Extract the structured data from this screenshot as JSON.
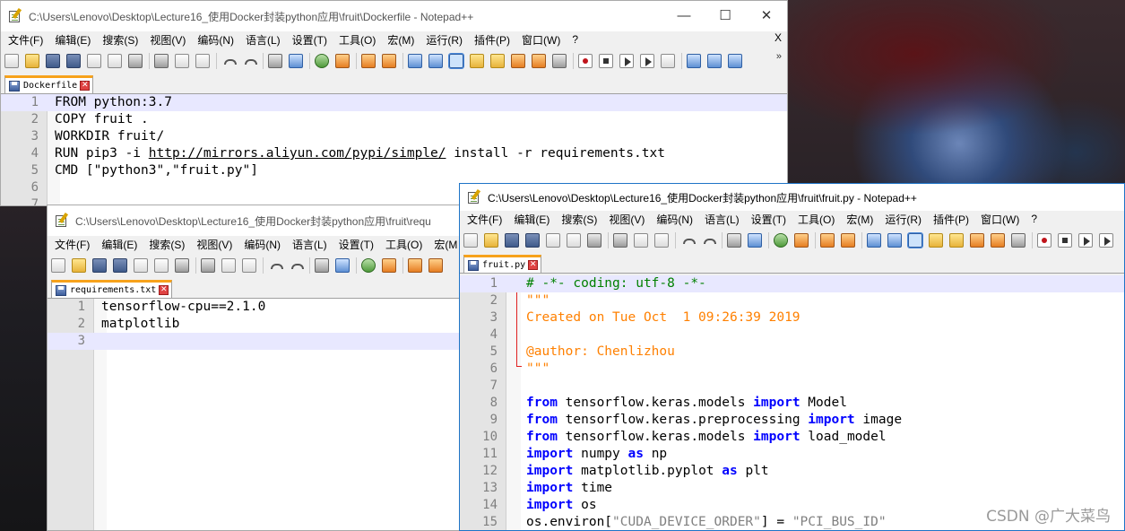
{
  "win1": {
    "title": "C:\\Users\\Lenovo\\Desktop\\Lecture16_使用Docker封装python应用\\fruit\\Dockerfile - Notepad++",
    "menus": [
      "文件(F)",
      "编辑(E)",
      "搜索(S)",
      "视图(V)",
      "编码(N)",
      "语言(L)",
      "设置(T)",
      "工具(O)",
      "宏(M)",
      "运行(R)",
      "插件(P)",
      "窗口(W)",
      "?"
    ],
    "menu_close": "X",
    "tab": "Dockerfile",
    "lines": [
      "1",
      "2",
      "3",
      "4",
      "5",
      "6",
      "7"
    ],
    "code": {
      "l1": "FROM python:3.7",
      "l2": "COPY fruit .",
      "l3": "WORKDIR fruit/",
      "l4_pre": "RUN pip3 -i ",
      "l4_url": "http://mirrors.aliyun.com/pypi/simple/",
      "l4_post": " install -r requirements.txt",
      "l5": "CMD [\"python3\",\"fruit.py\"]",
      "l6": "",
      "l7": ""
    }
  },
  "win2": {
    "title": "C:\\Users\\Lenovo\\Desktop\\Lecture16_使用Docker封装python应用\\fruit\\requ",
    "menus": [
      "文件(F)",
      "编辑(E)",
      "搜索(S)",
      "视图(V)",
      "编码(N)",
      "语言(L)",
      "设置(T)",
      "工具(O)",
      "宏(M"
    ],
    "tab": "requirements.txt",
    "lines": [
      "1",
      "2",
      "3"
    ],
    "code": [
      "tensorflow-cpu==2.1.0",
      "matplotlib",
      ""
    ]
  },
  "win3": {
    "title": "C:\\Users\\Lenovo\\Desktop\\Lecture16_使用Docker封装python应用\\fruit\\fruit.py - Notepad++",
    "menus": [
      "文件(F)",
      "编辑(E)",
      "搜索(S)",
      "视图(V)",
      "编码(N)",
      "语言(L)",
      "设置(T)",
      "工具(O)",
      "宏(M)",
      "运行(R)",
      "插件(P)",
      "窗口(W)",
      "?"
    ],
    "tab": "fruit.py",
    "lines": [
      "1",
      "2",
      "3",
      "4",
      "5",
      "6",
      "7",
      "8",
      "9",
      "10",
      "11",
      "12",
      "13",
      "14",
      "15"
    ],
    "code": {
      "l1": "# -*- coding: utf-8 -*-",
      "l2": "\"\"\"",
      "l3": "Created on Tue Oct  1 09:26:39 2019",
      "l4": "",
      "l5": "@author: Chenlizhou",
      "l6": "\"\"\"",
      "l7": "",
      "l8": {
        "k1": "from",
        "a": " tensorflow.keras.models ",
        "k2": "import",
        "b": " Model"
      },
      "l9": {
        "k1": "from",
        "a": " tensorflow.keras.preprocessing ",
        "k2": "import",
        "b": " image"
      },
      "l10": {
        "k1": "from",
        "a": " tensorflow.keras.models ",
        "k2": "import",
        "b": " load_model"
      },
      "l11": {
        "k1": "import",
        "a": " numpy ",
        "k2": "as",
        "b": " np"
      },
      "l12": {
        "k1": "import",
        "a": " matplotlib.pyplot ",
        "k2": "as",
        "b": " plt"
      },
      "l13": {
        "k1": "import",
        "a": " time"
      },
      "l14": {
        "k1": "import",
        "a": " os"
      },
      "l15": {
        "a": "os.environ[",
        "s1": "\"CUDA_DEVICE_ORDER\"",
        "b": "] = ",
        "s2": "\"PCI_BUS_ID\""
      }
    }
  },
  "watermark": "CSDN @广大菜鸟",
  "colors": {
    "keyword": "#0000ff",
    "string": "#ff8000",
    "comment": "#008000",
    "current_line": "#e8e8ff",
    "tab_accent": "#f7a21b"
  }
}
